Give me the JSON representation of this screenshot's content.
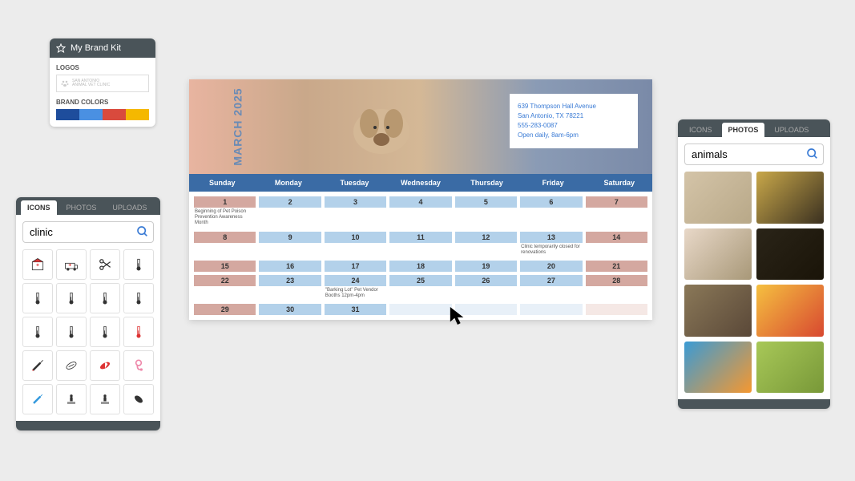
{
  "brandKit": {
    "title": "My Brand Kit",
    "logosLabel": "LOGOS",
    "logoText1": "SAN ANTONIO",
    "logoText2": "ANIMAL VET CLINIC",
    "colorsLabel": "BRAND COLORS",
    "colors": [
      "#1e4d9c",
      "#4a90e2",
      "#d94a3d",
      "#f5b800"
    ]
  },
  "iconsPanel": {
    "tabs": [
      "ICONS",
      "PHOTOS",
      "UPLOADS"
    ],
    "activeTab": 0,
    "searchValue": "clinic",
    "icons": [
      "first-aid",
      "ambulance",
      "scissors",
      "thermometer",
      "temp-low",
      "temp-med",
      "temp-diag",
      "temp-line",
      "temp-angle",
      "temp-vert",
      "temp-bulb",
      "temp-hot",
      "syringe",
      "pill",
      "capsule",
      "stethoscope",
      "injection",
      "massage",
      "treatment",
      "medicine"
    ]
  },
  "calendar": {
    "month": "MARCH",
    "year": "2025",
    "info": {
      "address": "639 Thompson Hall Avenue",
      "city": "San Antonio, TX 78221",
      "phone": "555-283-0087",
      "hours": "Open daily, 8am-6pm"
    },
    "dayNames": [
      "Sunday",
      "Monday",
      "Tuesday",
      "Wednesday",
      "Thursday",
      "Friday",
      "Saturday"
    ],
    "cells": [
      {
        "num": "1",
        "type": "pink",
        "event": "Beginning of Pet Poison Prevention Awareness Month"
      },
      {
        "num": "2",
        "type": "blue"
      },
      {
        "num": "3",
        "type": "blue"
      },
      {
        "num": "4",
        "type": "blue"
      },
      {
        "num": "5",
        "type": "blue"
      },
      {
        "num": "6",
        "type": "blue"
      },
      {
        "num": "7",
        "type": "pink"
      },
      {
        "num": "8",
        "type": "pink"
      },
      {
        "num": "9",
        "type": "blue"
      },
      {
        "num": "10",
        "type": "blue"
      },
      {
        "num": "11",
        "type": "blue"
      },
      {
        "num": "12",
        "type": "blue"
      },
      {
        "num": "13",
        "type": "blue",
        "event": "Clinic temporarily closed for renovations"
      },
      {
        "num": "14",
        "type": "pink"
      },
      {
        "num": "15",
        "type": "pink"
      },
      {
        "num": "16",
        "type": "blue"
      },
      {
        "num": "17",
        "type": "blue"
      },
      {
        "num": "18",
        "type": "blue"
      },
      {
        "num": "19",
        "type": "blue"
      },
      {
        "num": "20",
        "type": "blue"
      },
      {
        "num": "21",
        "type": "pink"
      },
      {
        "num": "22",
        "type": "pink"
      },
      {
        "num": "23",
        "type": "blue"
      },
      {
        "num": "24",
        "type": "blue",
        "event": "\"Barking Lot\" Pet Vendor Booths 12pm-4pm"
      },
      {
        "num": "25",
        "type": "blue"
      },
      {
        "num": "26",
        "type": "blue"
      },
      {
        "num": "27",
        "type": "blue"
      },
      {
        "num": "28",
        "type": "pink"
      },
      {
        "num": "29",
        "type": "pink"
      },
      {
        "num": "30",
        "type": "blue"
      },
      {
        "num": "31",
        "type": "blue"
      },
      {
        "num": "",
        "type": "faded-blue"
      },
      {
        "num": "",
        "type": "faded-blue"
      },
      {
        "num": "",
        "type": "faded-blue"
      },
      {
        "num": "",
        "type": "faded-pink"
      }
    ]
  },
  "photosPanel": {
    "tabs": [
      "ICONS",
      "PHOTOS",
      "UPLOADS"
    ],
    "activeTab": 1,
    "searchValue": "animals",
    "photos": [
      {
        "name": "horse",
        "bg": "linear-gradient(135deg,#d4c4a8,#b8a888)"
      },
      {
        "name": "lion-roar",
        "bg": "linear-gradient(135deg,#c9a84a,#3a3020)"
      },
      {
        "name": "puppy",
        "bg": "linear-gradient(135deg,#e8d8c8,#a89878)"
      },
      {
        "name": "lion-dark",
        "bg": "linear-gradient(135deg,#2a2418,#1a1408)"
      },
      {
        "name": "elephant",
        "bg": "linear-gradient(135deg,#8a7858,#5a4838)"
      },
      {
        "name": "flowers",
        "bg": "linear-gradient(135deg,#f5c040,#d84830)"
      },
      {
        "name": "kingfisher",
        "bg": "linear-gradient(135deg,#3a9bd5,#f59830)"
      },
      {
        "name": "meadow",
        "bg": "linear-gradient(135deg,#a8c858,#789838)"
      }
    ]
  }
}
